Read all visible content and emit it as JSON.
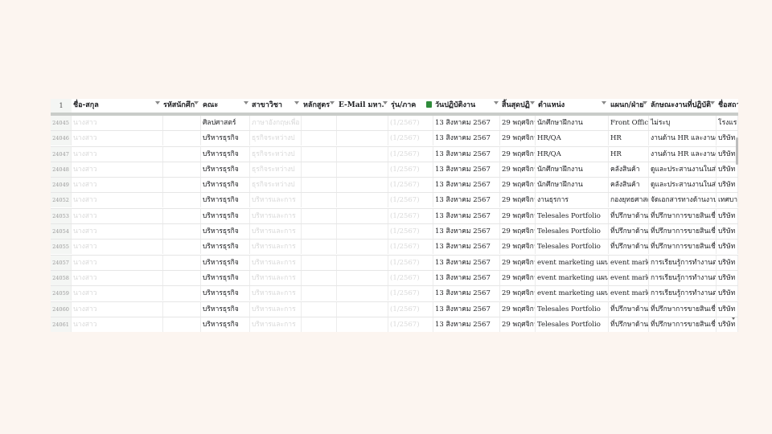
{
  "header": {
    "row_number": "1",
    "columns": [
      {
        "label": "ชื่อ-สกุล",
        "filter": true
      },
      {
        "label": "รหัสนักศึก",
        "filter": true
      },
      {
        "label": "คณะ",
        "filter": true
      },
      {
        "label": "สาขาวิชา",
        "filter": true
      },
      {
        "label": "หลักสูตร",
        "filter": true
      },
      {
        "label": "E-Mail มหา.",
        "filter": true
      },
      {
        "label": "รุ่น/ภาค",
        "filter": false
      },
      {
        "label": "วันปฏิบัติงาน",
        "filter": true
      },
      {
        "label": "สิ้นสุดปฏิ",
        "filter": true
      },
      {
        "label": "ตำแหน่ง",
        "filter": true
      },
      {
        "label": "แผนก/ฝ่าย",
        "filter": true
      },
      {
        "label": "ลักษณะงานที่ปฏิบัติ",
        "filter": true
      },
      {
        "label": "ชื่อสถา",
        "filter": false
      }
    ]
  },
  "rows": [
    {
      "n": "24045",
      "name": "นางสาว",
      "fac": "ศิลปศาสตร์",
      "major": "ภาษาอังกฤษเพื่อ",
      "gen": "(1/2567)",
      "start": "13 สิงหาคม 2567",
      "end": "29 พฤศจิกาย",
      "pos": "นักศึกษาฝึกงาน",
      "dept": "Front Office",
      "task": "ไม่ระบุ",
      "org": "โรงแรม"
    },
    {
      "n": "24046",
      "name": "นางสาว",
      "fac": "บริหารธุรกิจ",
      "major": "ธุรกิจระหว่างป",
      "gen": "(1/2567)",
      "start": "13 สิงหาคม 2567",
      "end": "29 พฤศจิกาย",
      "pos": "HR/QA",
      "dept": "HR",
      "task": "งานด้าน HR และงานด้าน",
      "org": "บริษัท"
    },
    {
      "n": "24047",
      "name": "นางสาว",
      "fac": "บริหารธุรกิจ",
      "major": "ธุรกิจระหว่างป",
      "gen": "(1/2567)",
      "start": "13 สิงหาคม 2567",
      "end": "29 พฤศจิกาย",
      "pos": "HR/QA",
      "dept": "HR",
      "task": "งานด้าน HR และงานด้าน",
      "org": "บริษัท"
    },
    {
      "n": "24048",
      "name": "นางสาว",
      "fac": "บริหารธุรกิจ",
      "major": "ธุรกิจระหว่างป",
      "gen": "(1/2567)",
      "start": "13 สิงหาคม 2567",
      "end": "29 พฤศจิกาย",
      "pos": "นักศึกษาฝึกงาน",
      "dept": "คลังสินค้า",
      "task": "ดูและประสานงานในส่วน",
      "org": "บริษัท"
    },
    {
      "n": "24049",
      "name": "นางสาว",
      "fac": "บริหารธุรกิจ",
      "major": "ธุรกิจระหว่างป",
      "gen": "(1/2567)",
      "start": "13 สิงหาคม 2567",
      "end": "29 พฤศจิกาย",
      "pos": "นักศึกษาฝึกงาน",
      "dept": "คลังสินค้า",
      "task": "ดูและประสานงานในส่วน",
      "org": "บริษัท"
    },
    {
      "n": "24052",
      "name": "นางสาว",
      "fac": "บริหารธุรกิจ",
      "major": "บริหารและการ",
      "gen": "(1/2567)",
      "start": "13 สิงหาคม 2567",
      "end": "29 พฤศจิกาย",
      "pos": "งานธุรการ",
      "dept": "กองยุทธศาสตร์",
      "task": "จัดเอกสารทางด้านงานธุร",
      "org": "เทศบาล"
    },
    {
      "n": "24053",
      "name": "นางสาว",
      "fac": "บริหารธุรกิจ",
      "major": "บริหารและการ",
      "gen": "(1/2567)",
      "start": "13 สิงหาคม 2567",
      "end": "29 พฤศจิกาย",
      "pos": "Telesales Portfolio",
      "dept": "ที่ปรึกษาด้านก",
      "task": "ที่ปรึกษาการขายสินเชื่อด้",
      "org": "บริษัท"
    },
    {
      "n": "24054",
      "name": "นางสาว",
      "fac": "บริหารธุรกิจ",
      "major": "บริหารและการ",
      "gen": "(1/2567)",
      "start": "13 สิงหาคม 2567",
      "end": "29 พฤศจิกาย",
      "pos": "Telesales Portfolio",
      "dept": "ที่ปรึกษาด้านก",
      "task": "ที่ปรึกษาการขายสินเชื่อด้",
      "org": "บริษัท"
    },
    {
      "n": "24055",
      "name": "นางสาว",
      "fac": "บริหารธุรกิจ",
      "major": "บริหารและการ",
      "gen": "(1/2567)",
      "start": "13 สิงหาคม 2567",
      "end": "29 พฤศจิกาย",
      "pos": "Telesales Portfolio",
      "dept": "ที่ปรึกษาด้านก",
      "task": "ที่ปรึกษาการขายสินเชื่อด้",
      "org": "บริษัท"
    },
    {
      "n": "24057",
      "name": "นางสาว",
      "fac": "บริหารธุรกิจ",
      "major": "บริหารและการ",
      "gen": "(1/2567)",
      "start": "13 สิงหาคม 2567",
      "end": "29 พฤศจิกาย",
      "pos": "event marketing แผนกการต",
      "dept": "event marketin",
      "task": "การเรียนรู้การทำงานต่างๆ",
      "org": "บริษัท"
    },
    {
      "n": "24058",
      "name": "นางสาว",
      "fac": "บริหารธุรกิจ",
      "major": "บริหารและการ",
      "gen": "(1/2567)",
      "start": "13 สิงหาคม 2567",
      "end": "29 พฤศจิกาย",
      "pos": "event marketing แผนกการต",
      "dept": "event marketin",
      "task": "การเรียนรู้การทำงานต่างๆ",
      "org": "บริษัท"
    },
    {
      "n": "24059",
      "name": "นางสาว",
      "fac": "บริหารธุรกิจ",
      "major": "บริหารและการ",
      "gen": "(1/2567)",
      "start": "13 สิงหาคม 2567",
      "end": "29 พฤศจิกาย",
      "pos": "event marketing แผนกการต",
      "dept": "event marketin",
      "task": "การเรียนรู้การทำงานต่างๆ",
      "org": "บริษัท"
    },
    {
      "n": "24060",
      "name": "นางสาว",
      "fac": "บริหารธุรกิจ",
      "major": "บริหารและการ",
      "gen": "(1/2567)",
      "start": "13 สิงหาคม 2567",
      "end": "29 พฤศจิกาย",
      "pos": "Telesales Portfolio",
      "dept": "ที่ปรึกษาด้านก",
      "task": "ที่ปรึกษาการขายสินเชื่อด้",
      "org": "บริษัท"
    },
    {
      "n": "24061",
      "name": "นางสาว",
      "fac": "บริหารธุรกิจ",
      "major": "บริหารและการ",
      "gen": "(1/2567)",
      "start": "13 สิงหาคม 2567",
      "end": "29 พฤศจิกาย",
      "pos": "Telesales Portfolio",
      "dept": "ที่ปรึกษาด้านก",
      "task": "ที่ปรึกษาการขายสินเชื่อด้",
      "org": "บริษัท"
    }
  ]
}
